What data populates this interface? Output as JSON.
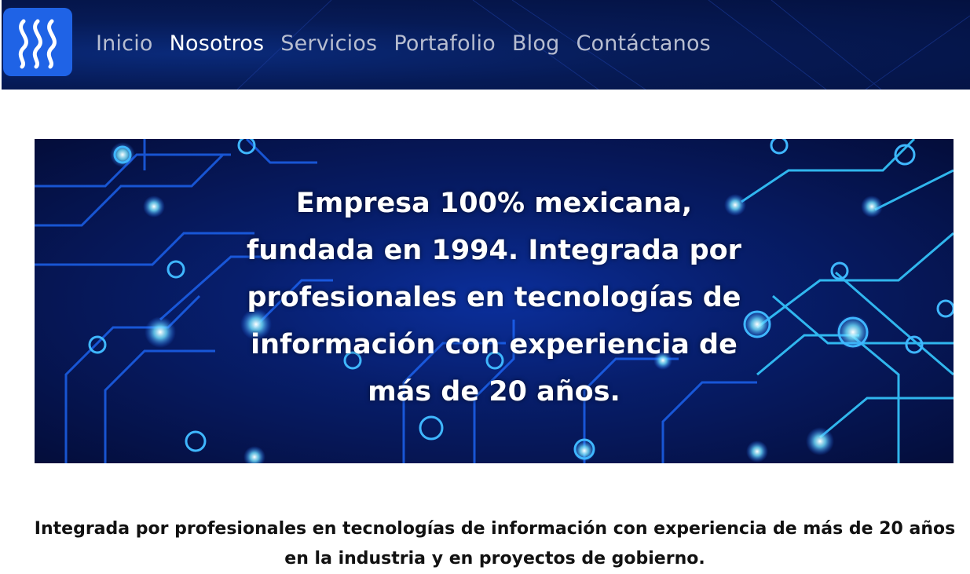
{
  "header": {
    "logo_alt": "SSS",
    "nav": [
      {
        "label": "Inicio",
        "active": false
      },
      {
        "label": "Nosotros",
        "active": true
      },
      {
        "label": "Servicios",
        "active": false
      },
      {
        "label": "Portafolio",
        "active": false
      },
      {
        "label": "Blog",
        "active": false
      },
      {
        "label": "Contáctanos",
        "active": false
      }
    ]
  },
  "hero": {
    "text": "Empresa 100% mexicana, fundada en 1994. Integrada por profesionales en tecnologías de información con experiencia de más de 20 años."
  },
  "about": {
    "text": "Integrada por profesionales en tecnologías de información con experiencia de más de 20 años en la industria y en proyectos de gobierno."
  },
  "colors": {
    "nav_bg": "#061a55",
    "logo_bg": "#1f63e6",
    "nav_text": "#b7bdd0",
    "nav_active": "#ffffff"
  }
}
